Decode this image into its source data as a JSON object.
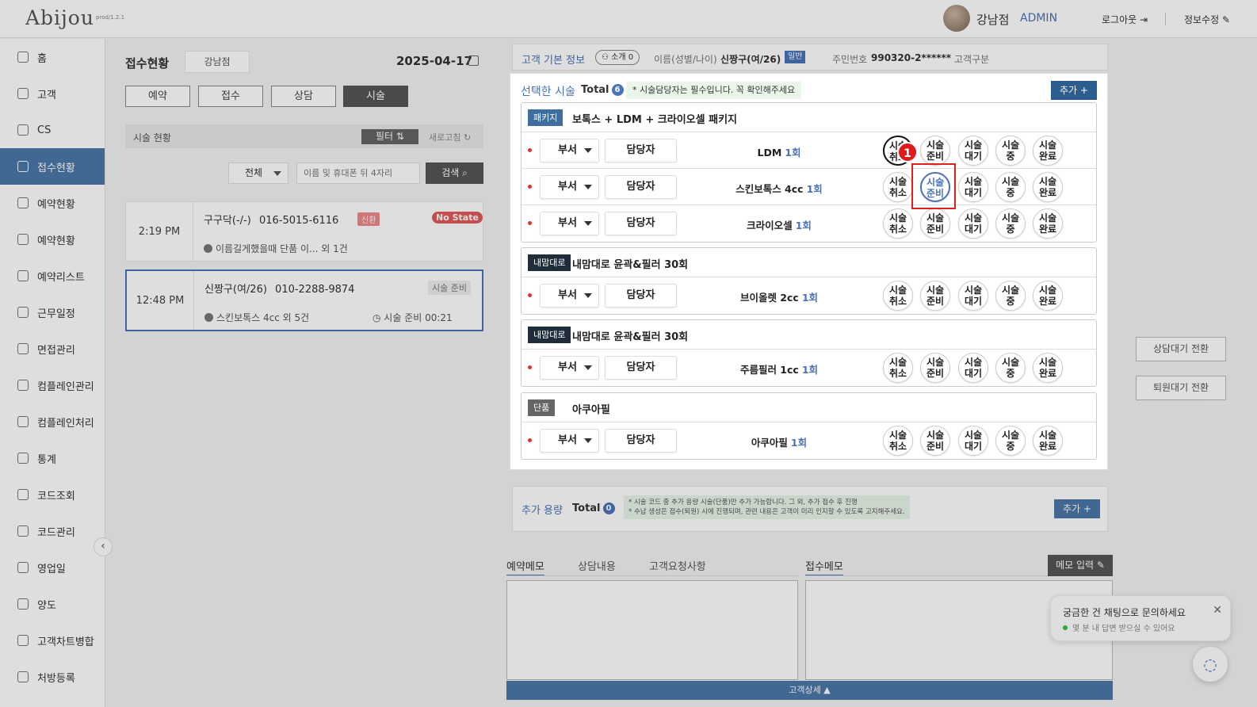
{
  "header": {
    "logo": "Abijou",
    "version": "prod/1.2.1",
    "store_name": "강남점",
    "role": "ADMIN",
    "logout": "로그아웃 ⇥",
    "edit_info": "정보수정 ✎"
  },
  "sidebar": {
    "items": [
      {
        "label": "홈",
        "icon": "home-icon"
      },
      {
        "label": "고객",
        "icon": "users-icon"
      },
      {
        "label": "CS",
        "icon": "cs-icon"
      },
      {
        "label": "접수현황",
        "icon": "reception-icon"
      },
      {
        "label": "예약현황",
        "icon": "calendar-icon"
      },
      {
        "label": "예약현황",
        "icon": "calendar-icon"
      },
      {
        "label": "예약리스트",
        "icon": "list-icon"
      },
      {
        "label": "근무일정",
        "icon": "schedule-icon"
      },
      {
        "label": "면접관리",
        "icon": "interview-icon"
      },
      {
        "label": "컴플레인관리",
        "icon": "complaint-icon"
      },
      {
        "label": "컴플레인처리",
        "icon": "complaint-process-icon"
      },
      {
        "label": "통계",
        "icon": "chart-icon"
      },
      {
        "label": "코드조회",
        "icon": "code-icon"
      },
      {
        "label": "코드관리",
        "icon": "code-manage-icon"
      },
      {
        "label": "영업일",
        "icon": "business-day-icon"
      },
      {
        "label": "양도",
        "icon": "transfer-icon"
      },
      {
        "label": "고객차트병합",
        "icon": "merge-icon"
      },
      {
        "label": "처방등록",
        "icon": "prescription-icon"
      }
    ],
    "active_index": 3,
    "collapse": "‹"
  },
  "reception": {
    "title": "접수현황",
    "branch": "강남점",
    "date": "2025-04-17",
    "tabs": [
      "예약",
      "접수",
      "상담",
      "시술"
    ],
    "active_tab": "시술",
    "section_title": "시술 현황",
    "filter_label": "필터 ⇅",
    "refresh_label": "새로고침 ↻",
    "select_value": "전체",
    "search_placeholder": "이름 및 휴대폰 뒤 4자리",
    "search_btn": "검색 ⌕",
    "cards": [
      {
        "time": "2:19 PM",
        "name": "구구닥(-/-)",
        "phone": "016-5015-6116",
        "tag": "신환",
        "state": "No State",
        "desc": "이름길게했을때 단품 이... 외 1건"
      },
      {
        "time": "12:48 PM",
        "name": "신짱구(여/26)",
        "phone": "010-2288-9874",
        "state": "시술 준비",
        "desc": "스킨보톡스 4cc 외 5건",
        "status_time": "시술 준비 00:21"
      }
    ]
  },
  "customer_info": {
    "title": "고객 기본 정보",
    "intro": "소개 0",
    "name_label": "이름(성별/나이)",
    "name_value": "신짱구(여/26)",
    "badge": "일반",
    "id_label": "주민번호",
    "id_value": "990320-2******",
    "type_label": "고객구분"
  },
  "selected_procedures": {
    "title": "선택한 시술",
    "total_label": "Total",
    "total": "6",
    "notice": "* 시술담당자는 필수입니다. 꼭 확인해주세요",
    "add_btn": "추가 +",
    "dept_label": "부서",
    "staff_label": "담당자",
    "status_buttons": [
      "시술\n취소",
      "시술\n준비",
      "시술\n대기",
      "시술\n중",
      "시술\n완료"
    ],
    "groups": [
      {
        "tag": "패키지",
        "tag_color": "#3f6e9f",
        "name": "보톡스 + LDM + 크라이오셀 패키지",
        "items": [
          {
            "name": "LDM",
            "count": "1회"
          },
          {
            "name": "스킨보톡스 4cc",
            "count": "1회"
          },
          {
            "name": "크라이오셀",
            "count": "1회"
          }
        ]
      },
      {
        "tag": "내맘대로",
        "tag_color": "#1f2c3a",
        "name": "내맘대로 윤곽&필러 30회",
        "items": [
          {
            "name": "브이올렛 2cc",
            "count": "1회"
          }
        ]
      },
      {
        "tag": "내맘대로",
        "tag_color": "#1f2c3a",
        "name": "내맘대로 윤곽&필러 30회",
        "items": [
          {
            "name": "주름필러 1cc",
            "count": "1회"
          }
        ]
      },
      {
        "tag": "단품",
        "tag_color": "#666666",
        "name": "아쿠아필",
        "items": [
          {
            "name": "아쿠아필",
            "count": "1회"
          }
        ]
      }
    ],
    "annotation_marker": "1"
  },
  "extra_dose": {
    "title": "추가 용량",
    "total_label": "Total",
    "total": "0",
    "note": "* 시술 코드 중 추가 용량 시술(단품)만 추가 가능합니다. 그 외, 추가 접수 후 진행\n* 수납 생성은 접수(퇴원) 시에 진행되며, 관련 내용은 고객이 미리 인지할 수 있도록 고지해주세요.",
    "add_btn": "추가 +"
  },
  "memo": {
    "tabs": [
      "예약메모",
      "상담내용",
      "고객요청사항"
    ],
    "right_tab": "접수메모",
    "input_btn": "메모 입력 ✎",
    "detail_bar": "고객상세 ▲"
  },
  "right_actions": {
    "consult_wait": "상담대기 전환",
    "discharge_wait": "퇴원대기 전환"
  },
  "chat": {
    "title": "궁금한 건 채팅으로 문의하세요",
    "subtitle": "몇 분 내 답변 받으실 수 있어요",
    "close": "✕",
    "fab": "◌"
  }
}
